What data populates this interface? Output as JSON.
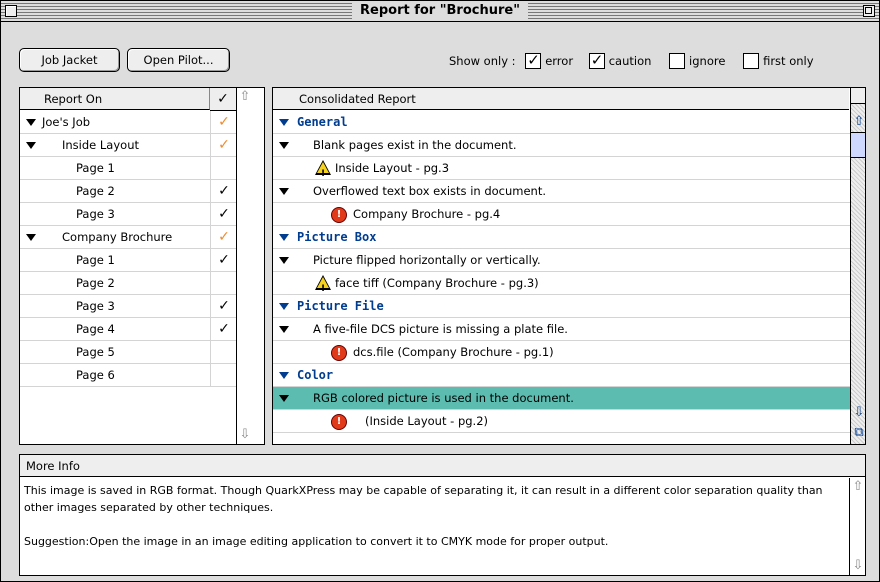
{
  "window": {
    "title": "Report for \"Brochure\""
  },
  "toolbar": {
    "job_jacket": "Job Jacket",
    "open_pilot": "Open Pilot...",
    "show_only_label": "Show only :",
    "filters": [
      {
        "label": "error",
        "checked": true
      },
      {
        "label": "caution",
        "checked": true
      },
      {
        "label": "ignore",
        "checked": false
      },
      {
        "label": "first only",
        "checked": false
      }
    ]
  },
  "report_on": {
    "header": "Report On",
    "check_header": "✓",
    "rows": [
      {
        "label": "Joe's Job",
        "level": 0,
        "expanded": true,
        "check": "✓",
        "check_color": "orange"
      },
      {
        "label": "Inside Layout",
        "level": 1,
        "expanded": true,
        "check": "✓",
        "check_color": "orange"
      },
      {
        "label": "Page 1",
        "level": 2,
        "check": ""
      },
      {
        "label": "Page 2",
        "level": 2,
        "check": "✓",
        "check_color": "black"
      },
      {
        "label": "Page 3",
        "level": 2,
        "check": "✓",
        "check_color": "black"
      },
      {
        "label": "Company Brochure",
        "level": 1,
        "expanded": true,
        "check": "✓",
        "check_color": "orange"
      },
      {
        "label": "Page 1",
        "level": 2,
        "check": "✓",
        "check_color": "black"
      },
      {
        "label": "Page 2",
        "level": 2,
        "check": ""
      },
      {
        "label": "Page 3",
        "level": 2,
        "check": "✓",
        "check_color": "black"
      },
      {
        "label": "Page 4",
        "level": 2,
        "check": "✓",
        "check_color": "black"
      },
      {
        "label": "Page 5",
        "level": 2,
        "check": ""
      },
      {
        "label": "Page 6",
        "level": 2,
        "check": ""
      }
    ]
  },
  "consolidated": {
    "header": "Consolidated Report",
    "rows": [
      {
        "kind": "category",
        "label": "General"
      },
      {
        "kind": "issue",
        "label": "Blank pages exist in the document."
      },
      {
        "kind": "detail",
        "icon": "caution",
        "label": "Inside Layout - pg.3"
      },
      {
        "kind": "issue",
        "label": "Overflowed text box exists in document."
      },
      {
        "kind": "detail",
        "icon": "error",
        "label": "Company Brochure - pg.4"
      },
      {
        "kind": "category",
        "label": "Picture Box"
      },
      {
        "kind": "issue",
        "label": "Picture flipped horizontally or vertically."
      },
      {
        "kind": "detail",
        "icon": "caution",
        "label": "face tiff  (Company Brochure - pg.3)"
      },
      {
        "kind": "category",
        "label": "Picture File"
      },
      {
        "kind": "issue",
        "label": "A five-file DCS picture is missing a plate file."
      },
      {
        "kind": "detail",
        "icon": "error",
        "label": "dcs.file  (Company Brochure - pg.1)"
      },
      {
        "kind": "category",
        "label": "Color"
      },
      {
        "kind": "issue",
        "label": "RGB colored picture is used in the document.",
        "selected": true
      },
      {
        "kind": "detail",
        "icon": "error",
        "label": "(Inside Layout - pg.2)"
      }
    ]
  },
  "more_info": {
    "header": "More Info",
    "paragraphs": [
      "This image is saved in RGB format. Though QuarkXPress may be capable of separating it, it can result in a different color separation quality than other images separated by other techniques.",
      "Suggestion:Open the image in an image editing application to convert it to CMYK mode for proper output."
    ]
  },
  "colors": {
    "selection": "#5cbcb0",
    "category_text": "#003c8f",
    "error_icon": "#e03a1a",
    "caution_icon": "#f5d21f",
    "partial_check": "#f08a2c"
  }
}
